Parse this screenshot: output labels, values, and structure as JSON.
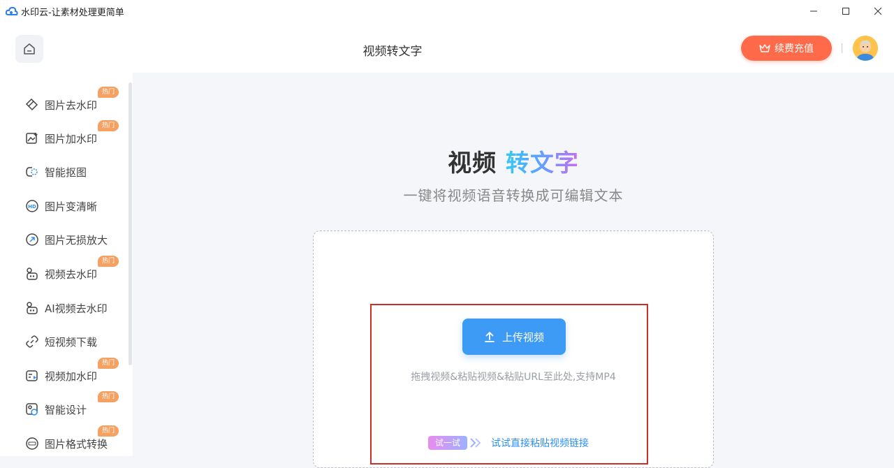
{
  "window": {
    "title": "水印云-让素材处理更简单",
    "controls": {
      "minimize": "—",
      "maximize": "☐",
      "close": "✕"
    }
  },
  "header": {
    "page_title": "视频转文字",
    "recharge_label": "续费充值",
    "accent_color": "#ff6b4a"
  },
  "sidebar": {
    "items": [
      {
        "label": "图片去水印",
        "icon": "eraser-icon",
        "badge": "热门"
      },
      {
        "label": "图片加水印",
        "icon": "image-add-icon",
        "badge": "热门"
      },
      {
        "label": "智能抠图",
        "icon": "cutout-icon",
        "badge": ""
      },
      {
        "label": "图片变清晰",
        "icon": "hd-icon",
        "badge": ""
      },
      {
        "label": "图片无损放大",
        "icon": "enlarge-icon",
        "badge": ""
      },
      {
        "label": "视频去水印",
        "icon": "video-eraser-icon",
        "badge": "热门"
      },
      {
        "label": "AI视频去水印",
        "icon": "ai-video-icon",
        "badge": ""
      },
      {
        "label": "短视频下载",
        "icon": "link-icon",
        "badge": ""
      },
      {
        "label": "视频加水印",
        "icon": "video-add-icon",
        "badge": "热门"
      },
      {
        "label": "智能设计",
        "icon": "design-icon",
        "badge": "热门"
      },
      {
        "label": "图片格式转换",
        "icon": "format-icon",
        "badge": "热门"
      }
    ]
  },
  "main": {
    "hero_title_part1": "视频",
    "hero_title_part2": "转文字",
    "hero_subtitle": "一键将视频语音转换成可编辑文本",
    "upload_label": "上传视频",
    "drop_hint": "拖拽视频&粘贴视频&粘贴URL至此处,支持MP4",
    "try_tag": "试一试",
    "try_link": "试试直接粘贴视频链接",
    "upload_color": "#3d9af5"
  }
}
